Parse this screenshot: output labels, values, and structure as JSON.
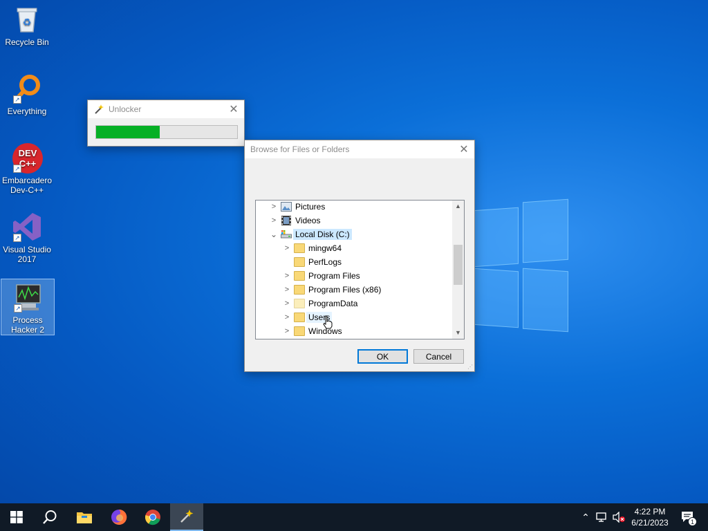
{
  "desktop": {
    "icons": [
      {
        "label": "Recycle Bin"
      },
      {
        "label": "Everything"
      },
      {
        "label": "Embarcadero Dev-C++"
      },
      {
        "label": "Visual Studio 2017"
      },
      {
        "label": "Process Hacker 2"
      }
    ],
    "devcpp_logo_line1": "DEV",
    "devcpp_logo_line2": "C++"
  },
  "unlocker": {
    "title": "Unlocker",
    "progress": 0.45,
    "progress_color": "#06b025"
  },
  "browse_dialog": {
    "title": "Browse for Files or Folders",
    "tree": [
      {
        "label": "Pictures",
        "icon": "pictures-icon",
        "expanded": false
      },
      {
        "label": "Videos",
        "icon": "videos-icon",
        "expanded": false
      },
      {
        "label": "Local Disk (C:)",
        "icon": "drive-icon",
        "expanded": true,
        "selected": true
      },
      {
        "label": "mingw64",
        "icon": "folder-icon",
        "expanded": false
      },
      {
        "label": "PerfLogs",
        "icon": "folder-icon"
      },
      {
        "label": "Program Files",
        "icon": "folder-icon",
        "expanded": false
      },
      {
        "label": "Program Files (x86)",
        "icon": "folder-icon",
        "expanded": false
      },
      {
        "label": "ProgramData",
        "icon": "folder-icon",
        "expanded": false
      },
      {
        "label": "Users",
        "icon": "folder-icon",
        "expanded": false,
        "hover": true
      },
      {
        "label": "Windows",
        "icon": "folder-icon",
        "expanded": false
      }
    ],
    "ok_label": "OK",
    "cancel_label": "Cancel"
  },
  "taskbar": {
    "time": "4:22 PM",
    "date": "6/21/2023",
    "notification_count": "1"
  },
  "colors": {
    "accent": "#0078d7",
    "selection": "#cce8ff",
    "taskbar": "#101a26"
  }
}
